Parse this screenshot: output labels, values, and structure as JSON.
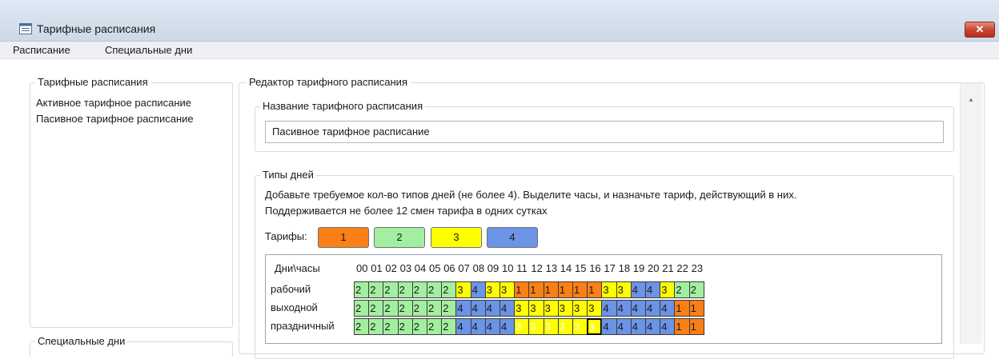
{
  "window": {
    "title": "Тарифные расписания",
    "close_label": "✕"
  },
  "menu": {
    "items": [
      "Расписание",
      "Специальные дни"
    ]
  },
  "left_panel": {
    "legend": "Тарифные расписания",
    "items": [
      "Активное тарифное расписание",
      "Пасивное тарифное расписание"
    ],
    "special_days_legend": "Специальные дни"
  },
  "editor": {
    "legend": "Редактор тарифного расписания",
    "name_legend": "Название тарифного расписания",
    "name_value": "Пасивное тарифное расписание",
    "day_types_legend": "Типы дней",
    "info_line1": "Добавьте требуемое кол-во типов дней (не более 4). Выделите часы, и назначьте тариф, действующий в них.",
    "info_line2": "Поддерживается не более 12 смен тарифа в одних сутках",
    "tariffs_label": "Тарифы:",
    "tariffs": [
      {
        "label": "1",
        "color": "#f97f16"
      },
      {
        "label": "2",
        "color": "#a3efa0"
      },
      {
        "label": "3",
        "color": "#ffff00"
      },
      {
        "label": "4",
        "color": "#6b93e6"
      }
    ]
  },
  "grid": {
    "corner_header": "Дни\\часы",
    "hours": [
      "00",
      "01",
      "02",
      "03",
      "04",
      "05",
      "06",
      "07",
      "08",
      "09",
      "10",
      "11",
      "12",
      "13",
      "14",
      "15",
      "16",
      "17",
      "18",
      "19",
      "20",
      "21",
      "22",
      "23"
    ],
    "rows": [
      {
        "name": "рабочий",
        "cells": [
          "2",
          "2",
          "2",
          "2",
          "2",
          "2",
          "2",
          "3",
          "4",
          "3",
          "3",
          "1",
          "1",
          "1",
          "1",
          "1",
          "1",
          "3",
          "3",
          "4",
          "4",
          "3",
          "2",
          "2"
        ]
      },
      {
        "name": "выходной",
        "cells": [
          "2",
          "2",
          "2",
          "2",
          "2",
          "2",
          "2",
          "4",
          "4",
          "4",
          "4",
          "3",
          "3",
          "3",
          "3",
          "3",
          "3",
          "4",
          "4",
          "4",
          "4",
          "4",
          "1",
          "1"
        ]
      },
      {
        "name": "праздничный",
        "cells": [
          "2",
          "2",
          "2",
          "2",
          "2",
          "2",
          "2",
          "4",
          "4",
          "4",
          "4",
          "3",
          "3",
          "3",
          "3",
          "3",
          "3",
          "4",
          "4",
          "4",
          "4",
          "4",
          "1",
          "1"
        ]
      }
    ],
    "selected": {
      "row": 2,
      "from_hour": 11,
      "to_hour": 16
    }
  }
}
